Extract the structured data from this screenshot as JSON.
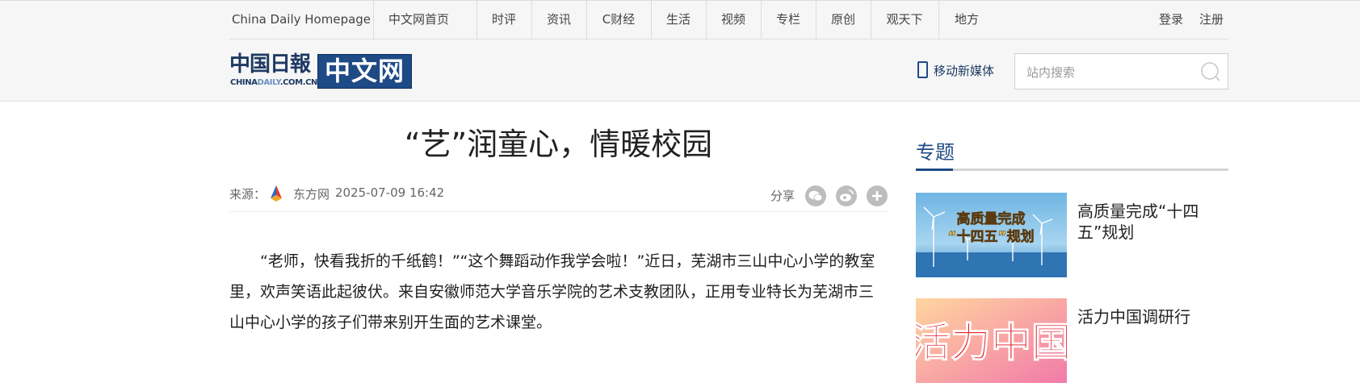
{
  "nav": {
    "items": [
      {
        "label": "China Daily Homepage"
      },
      {
        "label": "中文网首页"
      },
      {
        "label": "时评"
      },
      {
        "label": "资讯"
      },
      {
        "label": "C财经"
      },
      {
        "label": "生活"
      },
      {
        "label": "视频"
      },
      {
        "label": "专栏"
      },
      {
        "label": "原创"
      },
      {
        "label": "观天下"
      },
      {
        "label": "地方"
      }
    ],
    "login": "登录",
    "register": "注册"
  },
  "logo": {
    "cn_text": "中国日報",
    "en_text": "CHINADAILY.COM.CN",
    "en_highlight": "DAILY",
    "box_text": "中文网",
    "brand_color": "#1e4a86"
  },
  "header": {
    "mobile_label": "移动新媒体",
    "search_placeholder": "站内搜索",
    "search_value": ""
  },
  "article": {
    "title": "“艺”润童心，情暖校园",
    "source_label": "来源：",
    "source_name": "东方网",
    "publish_time": "2025-07-09 16:42",
    "share_label": "分享",
    "share_icons": [
      "wechat-icon",
      "weibo-icon",
      "plus-icon"
    ],
    "paragraph": "“老师，快看我折的千纸鹤！”“这个舞蹈动作我学会啦！”近日，芜湖市三山中心小学的教室里，欢声笑语此起彼伏。来自安徽师范大学音乐学院的艺术支教团队，正用专业特长为芜湖市三山中心小学的孩子们带来别开生面的艺术课堂。"
  },
  "sidebar": {
    "title": "专题",
    "items": [
      {
        "title": "高质量完成“十四五”规划",
        "image_text_line1": "高质量完成",
        "image_text_line2": "“十四五”规划"
      },
      {
        "title": "活力中国调研行",
        "image_text": "活力中国"
      }
    ]
  }
}
